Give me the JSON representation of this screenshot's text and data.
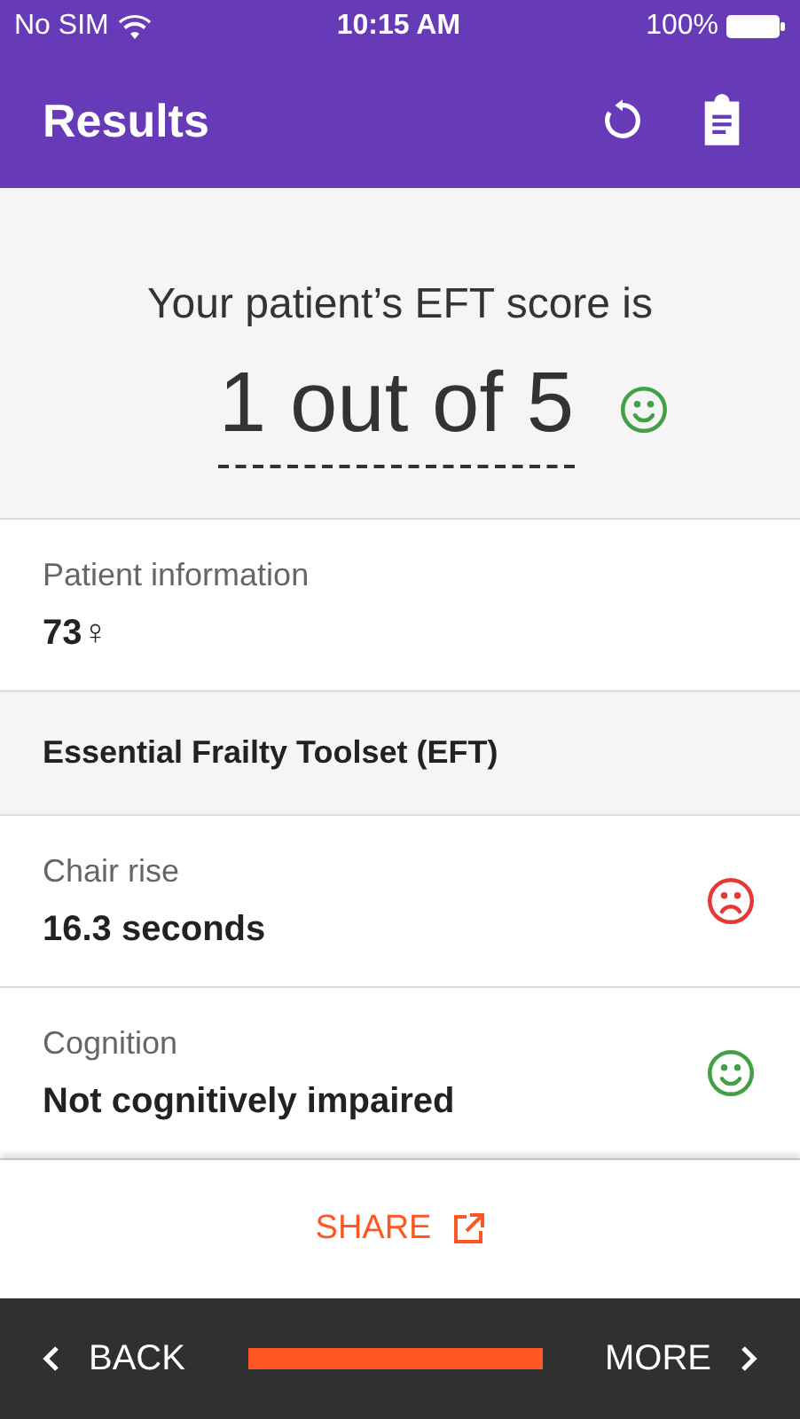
{
  "status_bar": {
    "carrier": "No SIM",
    "time": "10:15 AM",
    "battery": "100%"
  },
  "app_bar": {
    "title": "Results"
  },
  "score": {
    "caption": "Your patient’s EFT score is",
    "value": "1 out of 5",
    "positive": true
  },
  "patient": {
    "label": "Patient information",
    "value": "73♀"
  },
  "section": {
    "title": "Essential Frailty Toolset (EFT)"
  },
  "items": [
    {
      "label": "Chair rise",
      "value": "16.3 seconds",
      "positive": false
    },
    {
      "label": "Cognition",
      "value": "Not cognitively impaired",
      "positive": true
    }
  ],
  "share": {
    "label": "SHARE"
  },
  "nav": {
    "back": "BACK",
    "more": "MORE"
  }
}
